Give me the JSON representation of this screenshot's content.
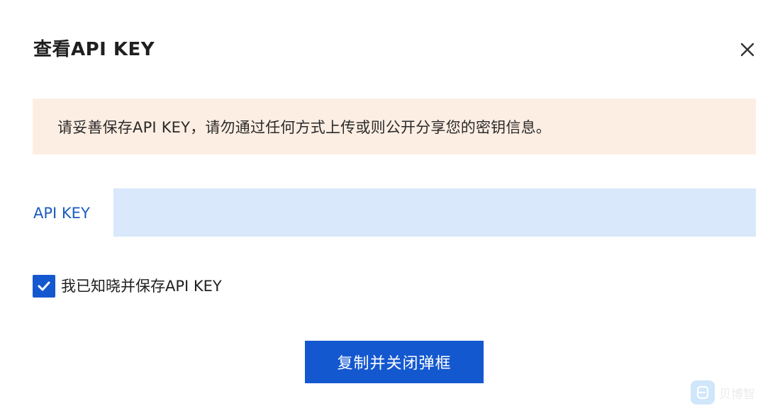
{
  "dialog": {
    "title": "查看API KEY",
    "close_icon": "close-icon",
    "warning_text": "请妥善保存API KEY，请勿通过任何方式上传或则公开分享您的密钥信息。",
    "warning_bg_color": "#fdeee3",
    "api_key_field": {
      "label": "API KEY",
      "value": ""
    },
    "acknowledge": {
      "label": "我已知晓并保存API KEY",
      "checked": true
    },
    "primary_button_label": "复制并关闭弹框",
    "accent_color": "#1458d0"
  },
  "watermark": {
    "logo_icon": "brand-logo-icon",
    "text": "贝博智"
  }
}
